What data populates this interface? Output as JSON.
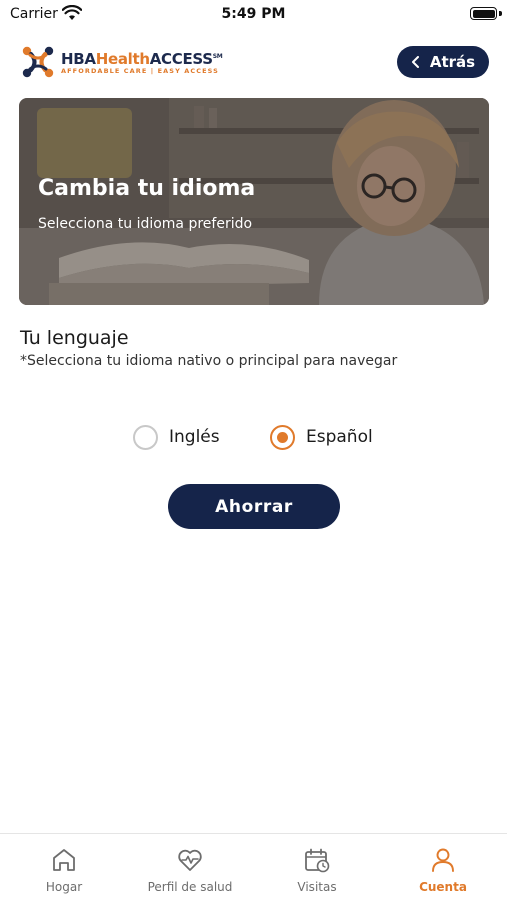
{
  "status_bar": {
    "carrier": "Carrier",
    "time": "5:49 PM"
  },
  "header": {
    "logo": {
      "hba": "HBA",
      "health": "Health",
      "access": "ACCESS",
      "sm": "SM",
      "tagline": "AFFORDABLE CARE | EASY ACCESS"
    },
    "back_label": "Atrás"
  },
  "hero": {
    "title": "Cambia tu idioma",
    "subtitle": "Selecciona tu idioma preferido"
  },
  "language": {
    "title": "Tu lenguaje",
    "note": "*Selecciona tu idioma nativo o principal para navegar",
    "options": [
      {
        "label": "Inglés",
        "selected": false
      },
      {
        "label": "Español",
        "selected": true
      }
    ],
    "save_label": "Ahorrar"
  },
  "tabs": [
    {
      "label": "Hogar",
      "icon": "home-icon",
      "active": false
    },
    {
      "label": "Perfil de salud",
      "icon": "heart-pulse-icon",
      "active": false
    },
    {
      "label": "Visitas",
      "icon": "calendar-clock-icon",
      "active": false
    },
    {
      "label": "Cuenta",
      "icon": "user-icon",
      "active": true
    }
  ],
  "colors": {
    "navy": "#15244a",
    "accent": "#e07a2b",
    "inactive": "#6d6d6d"
  }
}
